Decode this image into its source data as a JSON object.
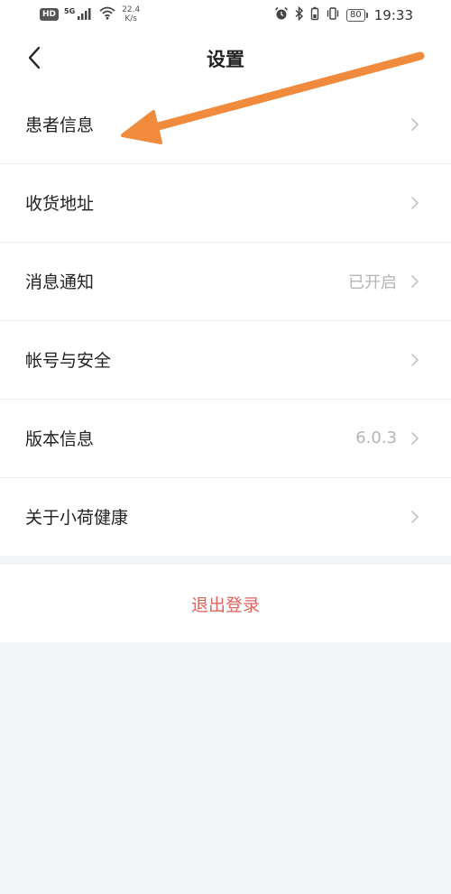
{
  "status_bar": {
    "hd_badge": "HD",
    "network_type": "5G",
    "speed_value": "22.4",
    "speed_unit": "K/s",
    "battery_level": "80",
    "time": "19:33",
    "icons": [
      "signal-icon",
      "wifi-icon",
      "alarm-icon",
      "bluetooth-icon",
      "battery-saver-icon",
      "vibrate-icon",
      "battery-icon"
    ]
  },
  "header": {
    "back_icon": "chevron-left-icon",
    "title": "设置"
  },
  "settings": {
    "items": [
      {
        "label": "患者信息",
        "value": ""
      },
      {
        "label": "收货地址",
        "value": ""
      },
      {
        "label": "消息通知",
        "value": "已开启"
      },
      {
        "label": "帐号与安全",
        "value": ""
      },
      {
        "label": "版本信息",
        "value": "6.0.3"
      },
      {
        "label": "关于小荷健康",
        "value": ""
      }
    ],
    "chevron_icon": "chevron-right-icon"
  },
  "logout": {
    "label": "退出登录"
  },
  "colors": {
    "page_background": "#f4f5f9",
    "logout_text": "#e2625d",
    "annotation_arrow": "#f08a3c",
    "secondary_text": "#b5b5b5"
  }
}
